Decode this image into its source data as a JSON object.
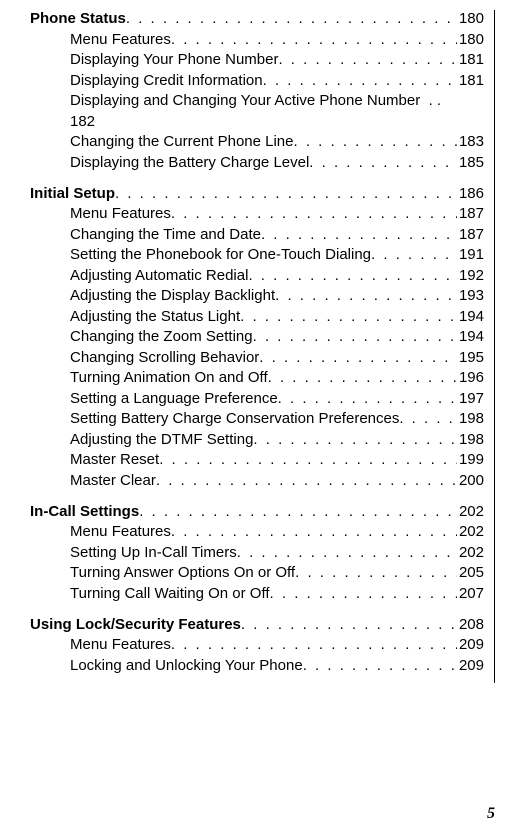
{
  "sections": [
    {
      "title": "Phone Status",
      "page": "180",
      "items": [
        {
          "label": "Menu Features",
          "page": "180"
        },
        {
          "label": "Displaying Your Phone Number",
          "page": "181"
        },
        {
          "label": "Displaying Credit Information",
          "page": "181"
        },
        {
          "label": "Displaying and Changing Your Active Phone Number",
          "page": "182",
          "wrap": true
        },
        {
          "label": "Changing the Current Phone Line",
          "page": "183"
        },
        {
          "label": "Displaying the Battery Charge Level",
          "page": "185"
        }
      ]
    },
    {
      "title": "Initial Setup",
      "page": "186",
      "items": [
        {
          "label": "Menu Features",
          "page": "187"
        },
        {
          "label": "Changing the Time and Date",
          "page": "187"
        },
        {
          "label": "Setting the Phonebook for One-Touch Dialing",
          "page": "191"
        },
        {
          "label": "Adjusting Automatic Redial",
          "page": "192"
        },
        {
          "label": "Adjusting the Display Backlight",
          "page": "193"
        },
        {
          "label": "Adjusting the Status Light",
          "page": "194"
        },
        {
          "label": "Changing the Zoom Setting",
          "page": "194"
        },
        {
          "label": "Changing Scrolling Behavior",
          "page": "195"
        },
        {
          "label": "Turning Animation On and Off",
          "page": "196"
        },
        {
          "label": "Setting a Language Preference",
          "page": "197"
        },
        {
          "label": "Setting Battery Charge Conservation Preferences",
          "page": "198"
        },
        {
          "label": "Adjusting the DTMF Setting",
          "page": "198"
        },
        {
          "label": "Master Reset",
          "page": "199"
        },
        {
          "label": "Master Clear",
          "page": "200"
        }
      ]
    },
    {
      "title": "In-Call Settings",
      "page": "202",
      "items": [
        {
          "label": "Menu Features",
          "page": "202"
        },
        {
          "label": "Setting Up In-Call Timers",
          "page": "202"
        },
        {
          "label": "Turning Answer Options On or Off",
          "page": "205"
        },
        {
          "label": "Turning Call Waiting On or Off",
          "page": "207"
        }
      ]
    },
    {
      "title": "Using Lock/Security Features",
      "page": "208",
      "items": [
        {
          "label": "Menu Features",
          "page": "209"
        },
        {
          "label": "Locking and Unlocking Your Phone",
          "page": "209"
        }
      ]
    }
  ],
  "page_number": "5"
}
